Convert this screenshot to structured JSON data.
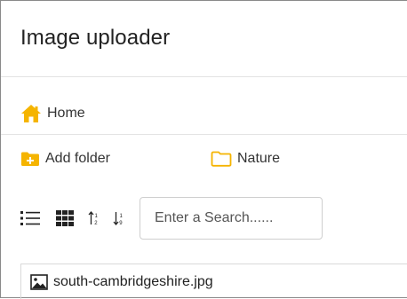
{
  "app": {
    "title": "Image uploader"
  },
  "breadcrumb": {
    "label": "Home",
    "icon": "home-icon",
    "icon_color": "#f5b400"
  },
  "folders": {
    "add_folder_label": "Add folder",
    "add_folder_icon": "folder-plus-icon",
    "items": [
      {
        "label": "Nature",
        "icon": "folder-outline-icon"
      }
    ],
    "folder_color": "#f5b400"
  },
  "toolbar": {
    "list_view_icon": "list-view-icon",
    "grid_view_icon": "grid-view-icon",
    "sort_asc_icon": "sort-ascending-icon",
    "sort_desc_icon": "sort-descending-icon",
    "search_placeholder": "Enter a Search......",
    "search_value": ""
  },
  "files": [
    {
      "name": "south-cambridgeshire.jpg",
      "icon": "image-file-icon"
    }
  ]
}
